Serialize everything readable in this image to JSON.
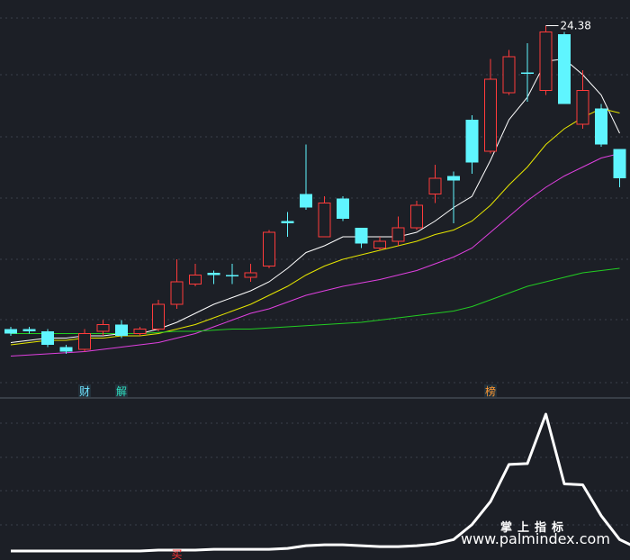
{
  "chart_data": [
    {
      "type": "candlestick",
      "panel": "main",
      "candles": [
        {
          "o": 10.7,
          "c": 10.9,
          "h": 11.0,
          "l": 10.6,
          "up": false
        },
        {
          "o": 10.9,
          "c": 10.8,
          "h": 11.0,
          "l": 10.7,
          "up": false
        },
        {
          "o": 10.8,
          "c": 10.2,
          "h": 10.9,
          "l": 10.1,
          "up": false
        },
        {
          "o": 10.1,
          "c": 9.9,
          "h": 10.2,
          "l": 9.8,
          "up": false
        },
        {
          "o": 10.0,
          "c": 10.7,
          "h": 10.9,
          "l": 9.9,
          "up": true
        },
        {
          "o": 10.8,
          "c": 11.1,
          "h": 11.3,
          "l": 10.6,
          "up": true
        },
        {
          "o": 11.1,
          "c": 10.6,
          "h": 11.3,
          "l": 10.5,
          "up": false
        },
        {
          "o": 10.7,
          "c": 10.9,
          "h": 11.0,
          "l": 10.6,
          "up": true
        },
        {
          "o": 10.9,
          "c": 12.0,
          "h": 12.2,
          "l": 10.8,
          "up": true
        },
        {
          "o": 12.0,
          "c": 13.0,
          "h": 14.0,
          "l": 11.8,
          "up": true
        },
        {
          "o": 12.9,
          "c": 13.3,
          "h": 13.8,
          "l": 12.8,
          "up": true
        },
        {
          "o": 13.4,
          "c": 13.3,
          "h": 13.5,
          "l": 12.9,
          "up": false
        },
        {
          "o": 13.3,
          "c": 13.3,
          "h": 13.8,
          "l": 12.9,
          "up": false
        },
        {
          "o": 13.2,
          "c": 13.4,
          "h": 13.8,
          "l": 13.0,
          "up": true
        },
        {
          "o": 13.7,
          "c": 15.2,
          "h": 15.3,
          "l": 13.6,
          "up": true
        },
        {
          "o": 15.7,
          "c": 15.6,
          "h": 16.1,
          "l": 15.0,
          "up": false
        },
        {
          "o": 16.3,
          "c": 16.9,
          "h": 19.1,
          "l": 16.2,
          "up": false
        },
        {
          "o": 15.0,
          "c": 16.5,
          "h": 16.8,
          "l": 15.0,
          "up": true
        },
        {
          "o": 16.7,
          "c": 15.8,
          "h": 16.8,
          "l": 15.7,
          "up": false
        },
        {
          "o": 15.4,
          "c": 14.7,
          "h": 15.4,
          "l": 14.5,
          "up": false
        },
        {
          "o": 14.5,
          "c": 14.8,
          "h": 15.0,
          "l": 14.4,
          "up": true
        },
        {
          "o": 14.8,
          "c": 15.4,
          "h": 15.9,
          "l": 14.6,
          "up": true
        },
        {
          "o": 15.4,
          "c": 16.4,
          "h": 16.6,
          "l": 15.3,
          "up": true
        },
        {
          "o": 16.9,
          "c": 17.6,
          "h": 18.2,
          "l": 16.5,
          "up": true
        },
        {
          "o": 17.7,
          "c": 17.5,
          "h": 17.9,
          "l": 15.6,
          "up": false
        },
        {
          "o": 20.2,
          "c": 18.3,
          "h": 20.4,
          "l": 17.8,
          "up": false
        },
        {
          "o": 18.8,
          "c": 22.0,
          "h": 22.9,
          "l": 18.7,
          "up": true
        },
        {
          "o": 21.4,
          "c": 23.0,
          "h": 23.3,
          "l": 21.3,
          "up": true
        },
        {
          "o": 22.3,
          "c": 22.3,
          "h": 23.6,
          "l": 21.0,
          "up": false
        },
        {
          "o": 21.5,
          "c": 24.1,
          "h": 24.38,
          "l": 21.3,
          "up": true
        },
        {
          "o": 24.0,
          "c": 20.9,
          "h": 24.1,
          "l": 20.9,
          "up": false
        },
        {
          "o": 21.5,
          "c": 20.0,
          "h": 22.4,
          "l": 19.8,
          "up": true
        },
        {
          "o": 20.7,
          "c": 19.1,
          "h": 20.9,
          "l": 19.0,
          "up": false
        },
        {
          "o": 18.9,
          "c": 17.6,
          "h": 18.9,
          "l": 17.2,
          "up": false
        }
      ],
      "moving_averages": [
        {
          "color": "#ffffff",
          "values": [
            10.3,
            10.4,
            10.5,
            10.5,
            10.6,
            10.6,
            10.7,
            10.7,
            10.9,
            11.2,
            11.6,
            12.0,
            12.3,
            12.6,
            13.0,
            13.6,
            14.3,
            14.6,
            15.0,
            15.0,
            15.0,
            15.0,
            15.2,
            15.7,
            16.3,
            16.8,
            18.4,
            20.2,
            21.2,
            22.8,
            22.9,
            22.2,
            21.3,
            19.6
          ]
        },
        {
          "color": "#e6e600",
          "values": [
            10.2,
            10.3,
            10.4,
            10.4,
            10.5,
            10.5,
            10.6,
            10.6,
            10.7,
            10.9,
            11.1,
            11.4,
            11.7,
            12.0,
            12.4,
            12.8,
            13.3,
            13.7,
            14.0,
            14.2,
            14.4,
            14.6,
            14.8,
            15.1,
            15.3,
            15.7,
            16.4,
            17.3,
            18.1,
            19.1,
            19.8,
            20.3,
            20.7,
            20.5
          ]
        },
        {
          "color": "#e040e0",
          "values": [
            9.7,
            9.75,
            9.8,
            9.85,
            9.9,
            10.0,
            10.1,
            10.2,
            10.3,
            10.5,
            10.7,
            11.0,
            11.3,
            11.6,
            11.8,
            12.1,
            12.4,
            12.6,
            12.8,
            12.95,
            13.1,
            13.3,
            13.5,
            13.8,
            14.1,
            14.5,
            15.2,
            15.9,
            16.6,
            17.2,
            17.7,
            18.1,
            18.5,
            18.7
          ]
        },
        {
          "color": "#22cc22",
          "values": [
            10.7,
            10.7,
            10.7,
            10.7,
            10.7,
            10.7,
            10.7,
            10.7,
            10.75,
            10.8,
            10.8,
            10.85,
            10.9,
            10.9,
            10.95,
            11.0,
            11.05,
            11.1,
            11.15,
            11.2,
            11.3,
            11.4,
            11.5,
            11.6,
            11.7,
            11.9,
            12.2,
            12.5,
            12.8,
            13.0,
            13.2,
            13.4,
            13.5,
            13.6
          ]
        }
      ],
      "high_label": "24.38",
      "ylim": [
        9.2,
        25.2
      ]
    },
    {
      "type": "line",
      "panel": "indicator",
      "values": [
        2,
        2,
        2,
        2,
        2,
        2,
        2,
        2,
        3,
        3,
        3,
        4,
        4,
        4,
        4,
        5,
        8,
        9,
        9,
        8,
        7,
        7,
        8,
        10,
        15,
        32,
        58,
        100,
        101,
        157,
        78,
        77,
        42,
        15,
        5
      ]
    }
  ],
  "markers": [
    {
      "text": "财",
      "candle": 4,
      "color": "#6fe3ff"
    },
    {
      "text": "解",
      "candle": 6,
      "color": "#2fe0c0"
    },
    {
      "text": "榜",
      "candle": 26,
      "color": "#ff9933"
    },
    {
      "text": "买",
      "candle": 9,
      "color": "#ff3333"
    }
  ],
  "watermark": {
    "cn": "掌上指标",
    "url": "www.palmindex.com"
  },
  "colors": {
    "up": "#ff3b3b",
    "down": "#5ff5ff",
    "bg": "#1c1f26",
    "grid": "#3a3f4a"
  }
}
